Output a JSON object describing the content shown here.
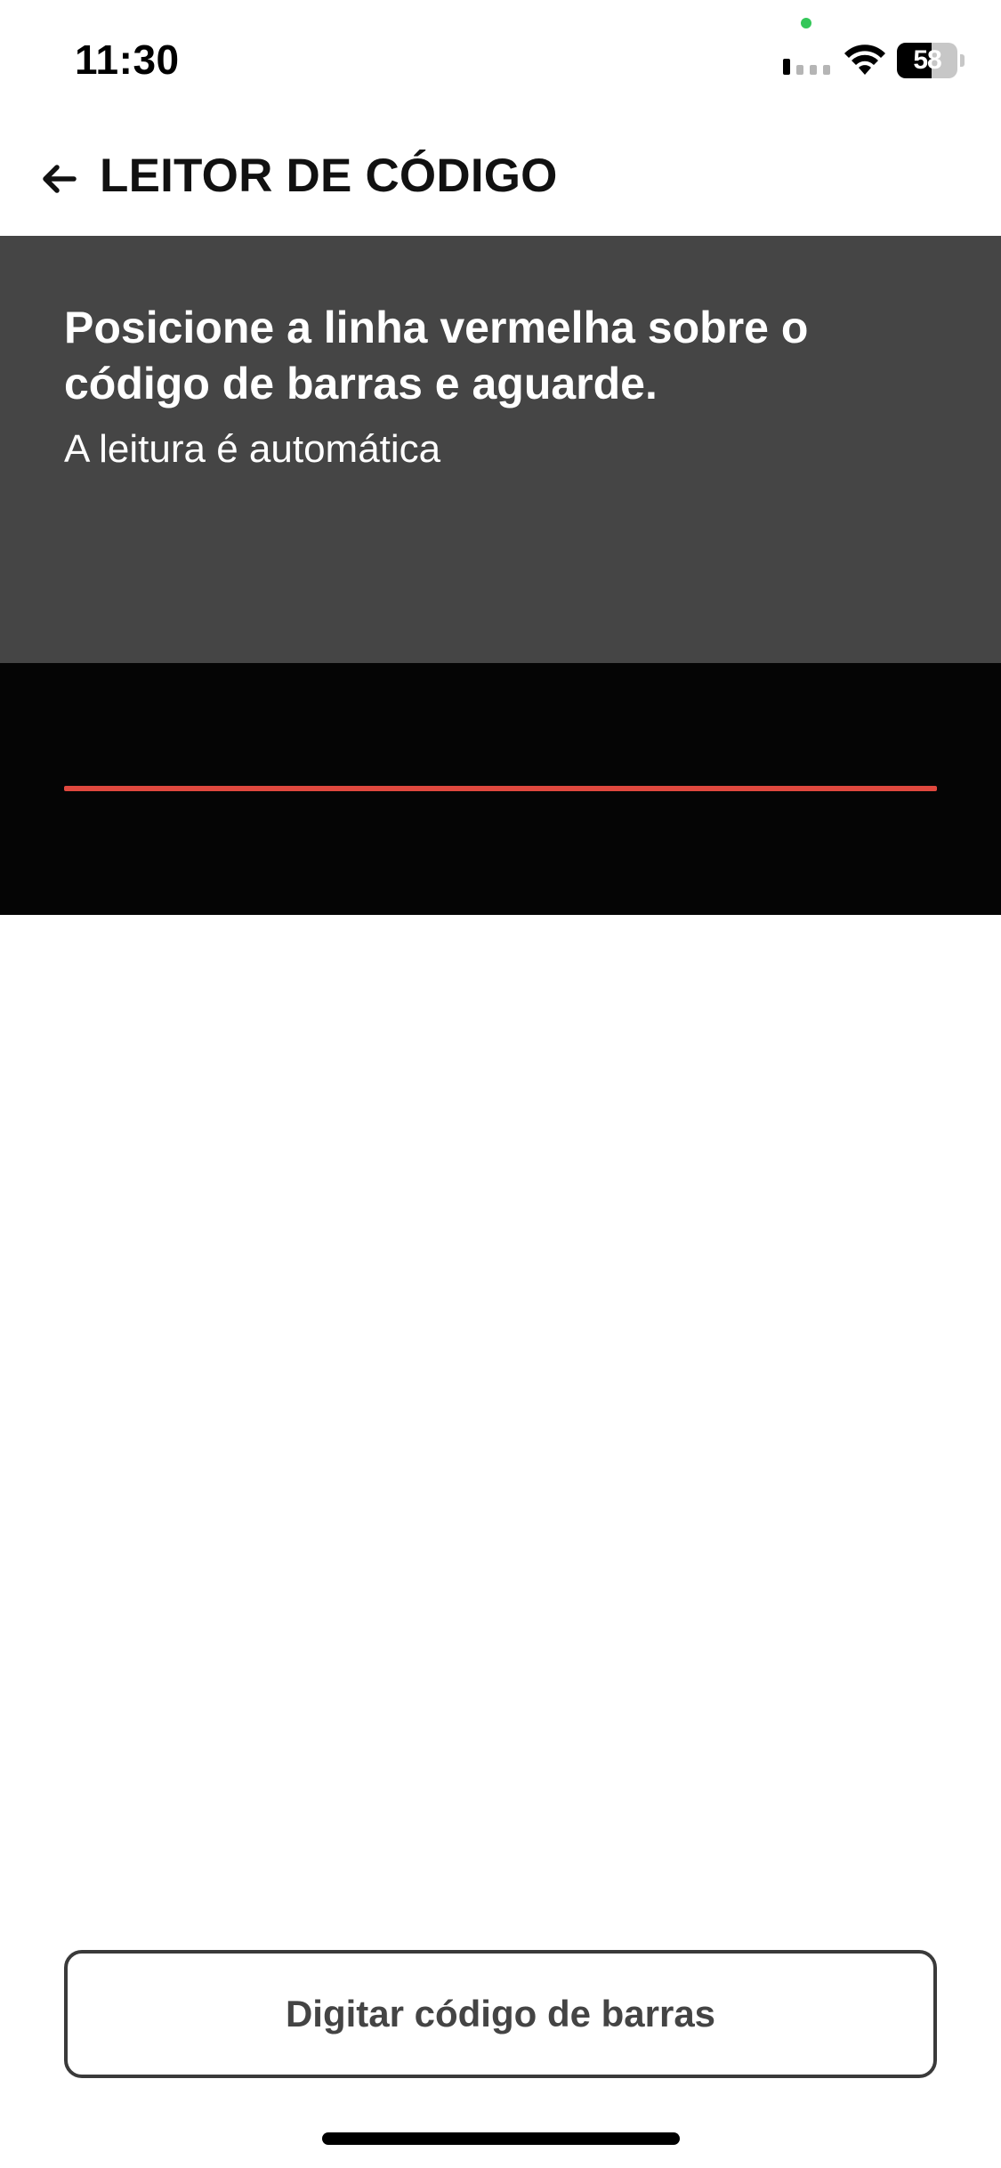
{
  "status_bar": {
    "time": "11:30",
    "battery_level": "58",
    "battery_fraction": 0.58,
    "mic_indicator_color": "#34c759",
    "icons": [
      "signal-icon",
      "wifi-icon",
      "battery-icon"
    ]
  },
  "header": {
    "title": "LEITOR DE CÓDIGO",
    "back_icon": "arrow-left-icon"
  },
  "instructions": {
    "title": "Posicione a linha vermelha sobre o código de barras e aguarde.",
    "subtitle": "A leitura é automática"
  },
  "scanner": {
    "scan_line_color": "#e0483e"
  },
  "actions": {
    "manual_entry_label": "Digitar código de barras"
  }
}
